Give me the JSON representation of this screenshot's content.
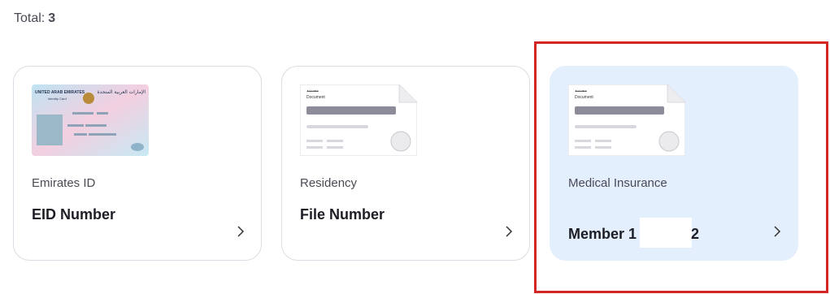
{
  "header": {
    "total_label": "Total:",
    "total_count": "3"
  },
  "cards": [
    {
      "label": "Emirates ID",
      "value": "EID Number",
      "thumbnail": "emirates-id-card-icon",
      "thumb_text": {
        "country_en": "UNITED ARAB EMIRATES",
        "country_ar": "الإمارات العربية المتحدة",
        "card_type": "Identity Card"
      }
    },
    {
      "label": "Residency",
      "value": "File Number",
      "thumbnail": "document-icon",
      "thumb_text": {
        "title_ar": "مستند",
        "title_en": "Document"
      }
    },
    {
      "label": "Medical Insurance",
      "value_start": "Member 1",
      "value_end": "2",
      "thumbnail": "document-icon",
      "selected": true,
      "thumb_text": {
        "title_ar": "مستند",
        "title_en": "Document"
      }
    }
  ],
  "colors": {
    "selected_bg": "#e3effc",
    "highlight_border": "#d42525",
    "card_border": "#dcdce4"
  }
}
